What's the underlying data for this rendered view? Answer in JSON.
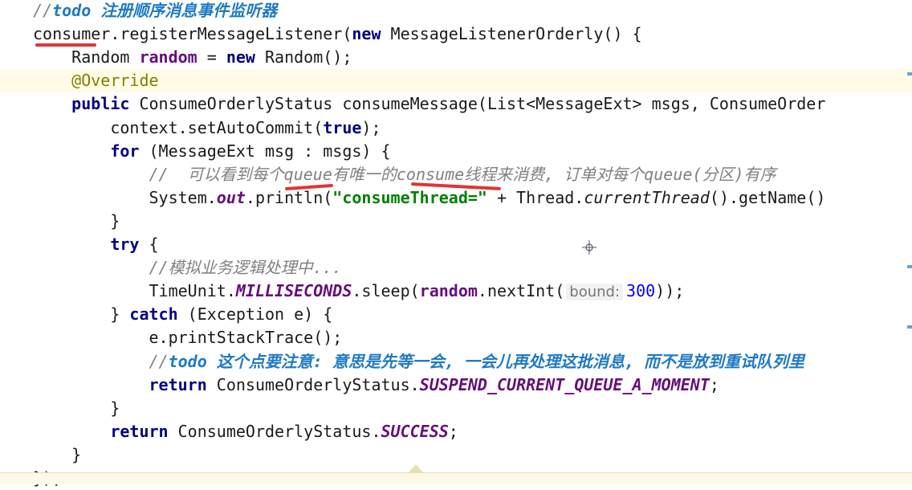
{
  "editor": {
    "lines": [
      {
        "id": "l0",
        "segments": [
          [
            "cmt",
            "//"
          ],
          [
            "todo",
            "todo "
          ],
          [
            "todo",
            "注册顺序消息事件监听器"
          ]
        ]
      },
      {
        "id": "l1",
        "segments": [
          [
            "",
            "consumer.registerMessageListener("
          ],
          [
            "kw",
            "new"
          ],
          [
            "",
            " MessageListenerOrderly() {"
          ]
        ]
      },
      {
        "id": "l2",
        "segments": [
          [
            "",
            "    Random "
          ],
          [
            "field",
            "random"
          ],
          [
            "",
            " = "
          ],
          [
            "kw",
            "new"
          ],
          [
            "",
            " Random();"
          ]
        ]
      },
      {
        "id": "l3",
        "segments": [
          [
            "ann",
            "    @Override"
          ]
        ]
      },
      {
        "id": "l4",
        "segments": [
          [
            "kw",
            "    public"
          ],
          [
            "",
            " ConsumeOrderlyStatus consumeMessage(List<MessageExt> msgs, ConsumeOrder"
          ]
        ]
      },
      {
        "id": "l5",
        "segments": [
          [
            "",
            "        context.setAutoCommit("
          ],
          [
            "kw",
            "true"
          ],
          [
            "",
            ");"
          ]
        ]
      },
      {
        "id": "l6",
        "segments": [
          [
            "kw",
            "        for"
          ],
          [
            "",
            " (MessageExt msg : msgs) {"
          ]
        ]
      },
      {
        "id": "l7",
        "segments": [
          [
            "cmt",
            "            //  可以看到每个queue有唯一的consume线程来消费, 订单对每个queue(分区)有序"
          ]
        ]
      },
      {
        "id": "l8",
        "segments": [
          [
            "",
            "            System."
          ],
          [
            "static",
            "out"
          ],
          [
            "",
            ".println("
          ],
          [
            "str",
            "\"consumeThread=\""
          ],
          [
            "",
            " + Thread."
          ],
          [
            "ital",
            "currentThread"
          ],
          [
            "",
            "().getName()"
          ]
        ]
      },
      {
        "id": "l9",
        "segments": [
          [
            "",
            "        }"
          ]
        ]
      },
      {
        "id": "l10",
        "segments": [
          [
            "kw",
            "        try"
          ],
          [
            "",
            " {"
          ]
        ]
      },
      {
        "id": "l11",
        "segments": [
          [
            "cmt",
            "            //模拟业务逻辑处理中..."
          ]
        ]
      },
      {
        "id": "l12",
        "segments": [
          [
            "",
            "            TimeUnit."
          ],
          [
            "static",
            "MILLISECONDS"
          ],
          [
            "",
            ".sleep("
          ],
          [
            "field",
            "random"
          ],
          [
            "",
            ".nextInt("
          ],
          [
            "hint",
            "bound:"
          ],
          [
            "hintval",
            "300"
          ],
          [
            "",
            "));"
          ]
        ]
      },
      {
        "id": "l13",
        "segments": [
          [
            "",
            "        } "
          ],
          [
            "kw",
            "catch"
          ],
          [
            "",
            " (Exception e) {"
          ]
        ]
      },
      {
        "id": "l14",
        "segments": [
          [
            "",
            "            e.printStackTrace();"
          ]
        ]
      },
      {
        "id": "l15",
        "segments": [
          [
            "cmt",
            "            //"
          ],
          [
            "todo",
            "todo "
          ],
          [
            "todo",
            "这个点要注意: 意思是先等一会, 一会儿再处理这批消息, 而不是放到重试队列里"
          ]
        ]
      },
      {
        "id": "l16",
        "segments": [
          [
            "kw",
            "            return"
          ],
          [
            "",
            " ConsumeOrderlyStatus."
          ],
          [
            "static",
            "SUSPEND_CURRENT_QUEUE_A_MOMENT"
          ],
          [
            "",
            ";"
          ]
        ]
      },
      {
        "id": "l17",
        "segments": [
          [
            "",
            "        }"
          ]
        ]
      },
      {
        "id": "l18",
        "segments": [
          [
            "kw",
            "        return"
          ],
          [
            "",
            " ConsumeOrderlyStatus."
          ],
          [
            "static",
            "SUCCESS"
          ],
          [
            "",
            ";"
          ]
        ]
      },
      {
        "id": "l19",
        "segments": [
          [
            "",
            "    }"
          ]
        ]
      },
      {
        "id": "l20",
        "segments": [
          [
            "",
            "});"
          ]
        ]
      }
    ],
    "highlighted_line": 3,
    "colors": {
      "keyword": "#000080",
      "field": "#660e7a",
      "string": "#008000",
      "number": "#0000ff",
      "annotation": "#808000",
      "comment": "#808080",
      "todo": "#1f7ac2",
      "underline": "#e03535"
    },
    "cursor_icon": "crosshair-icon"
  }
}
